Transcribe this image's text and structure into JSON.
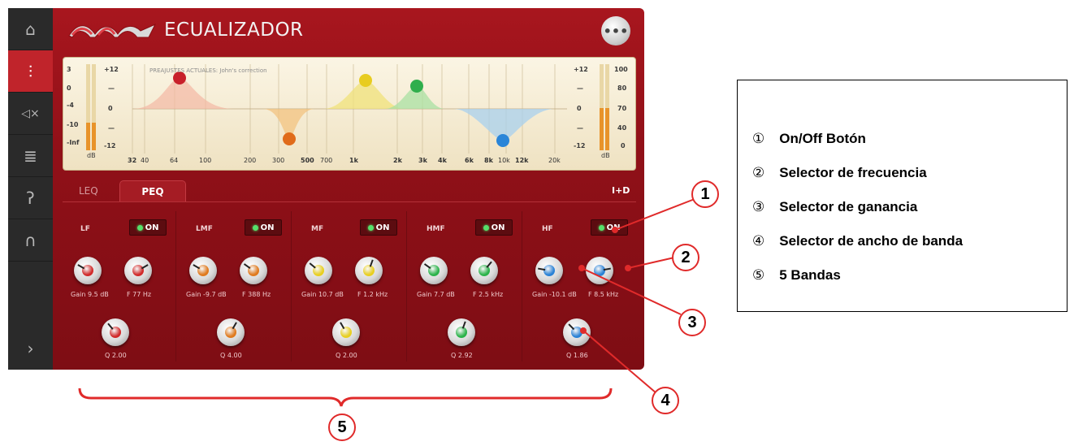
{
  "app": {
    "title": "ECUALIZADOR",
    "menu_label": "•••"
  },
  "sidebar": {
    "items": [
      {
        "name": "home",
        "glyph": "⌂"
      },
      {
        "name": "equalizer",
        "glyph": "⫶"
      },
      {
        "name": "speaker-mute",
        "glyph": "◁×"
      },
      {
        "name": "levels",
        "glyph": "≣"
      },
      {
        "name": "hearing",
        "glyph": "ʔ"
      },
      {
        "name": "headphones",
        "glyph": "∩"
      },
      {
        "name": "next",
        "glyph": "›"
      }
    ]
  },
  "graph": {
    "preset": "PREAJUSTES ACTUALES: John's correction",
    "left_scale": [
      "3",
      "0",
      "-4",
      "-10",
      "-Inf"
    ],
    "left_unit": "dB",
    "gain_scale": [
      "+12",
      "—",
      "0",
      "—",
      "-12"
    ],
    "right_gain_scale": [
      "+12",
      "—",
      "0",
      "—",
      "-12"
    ],
    "right_scale": [
      "100",
      "80",
      "70",
      "40",
      "0"
    ],
    "right_unit": "dB",
    "freq_labels": [
      "32",
      "40",
      "64",
      "100",
      "200",
      "300",
      "500",
      "700",
      "1k",
      "2k",
      "3k",
      "4k",
      "6k",
      "8k",
      "10k",
      "12k",
      "20k"
    ],
    "freq_bold": [
      "32",
      "500",
      "1k",
      "2k",
      "3k",
      "4k",
      "6k",
      "8k",
      "12k"
    ]
  },
  "tabs": {
    "leq": "LEQ",
    "peq": "PEQ",
    "id": "I+D"
  },
  "bands": [
    {
      "name": "LF",
      "on": "ON",
      "color": "#d12a2a",
      "gain": "Gain 9.5 dB",
      "freq": "F 77 Hz",
      "q": "Q 2.00",
      "gain_value": 9.5
    },
    {
      "name": "LMF",
      "on": "ON",
      "color": "#e07a1e",
      "gain": "Gain -9.7 dB",
      "freq": "F 388 Hz",
      "q": "Q 4.00",
      "gain_value": -9.7
    },
    {
      "name": "MF",
      "on": "ON",
      "color": "#e8cf1f",
      "gain": "Gain 10.7 dB",
      "freq": "F 1.2 kHz",
      "q": "Q 2.00",
      "gain_value": 10.7
    },
    {
      "name": "HMF",
      "on": "ON",
      "color": "#2bb34a",
      "gain": "Gain 7.7 dB",
      "freq": "F 2.5 kHz",
      "q": "Q 2.92",
      "gain_value": 7.7
    },
    {
      "name": "HF",
      "on": "ON",
      "color": "#2a82d6",
      "gain": "Gain -10.1 dB",
      "freq": "F 8.5 kHz",
      "q": "Q 1.86",
      "gain_value": -10.1
    }
  ],
  "legend": [
    {
      "num": "①",
      "text": "On/Off Botón"
    },
    {
      "num": "②",
      "text": "Selector de frecuencia"
    },
    {
      "num": "③",
      "text": "Selector de ganancia"
    },
    {
      "num": "④",
      "text": "Selector de ancho de banda"
    },
    {
      "num": "⑤",
      "text": "5 Bandas"
    }
  ],
  "callouts": [
    "1",
    "2",
    "3",
    "4",
    "5"
  ],
  "colors": {
    "accent": "#e02a2a",
    "panel": "#a8161e"
  }
}
